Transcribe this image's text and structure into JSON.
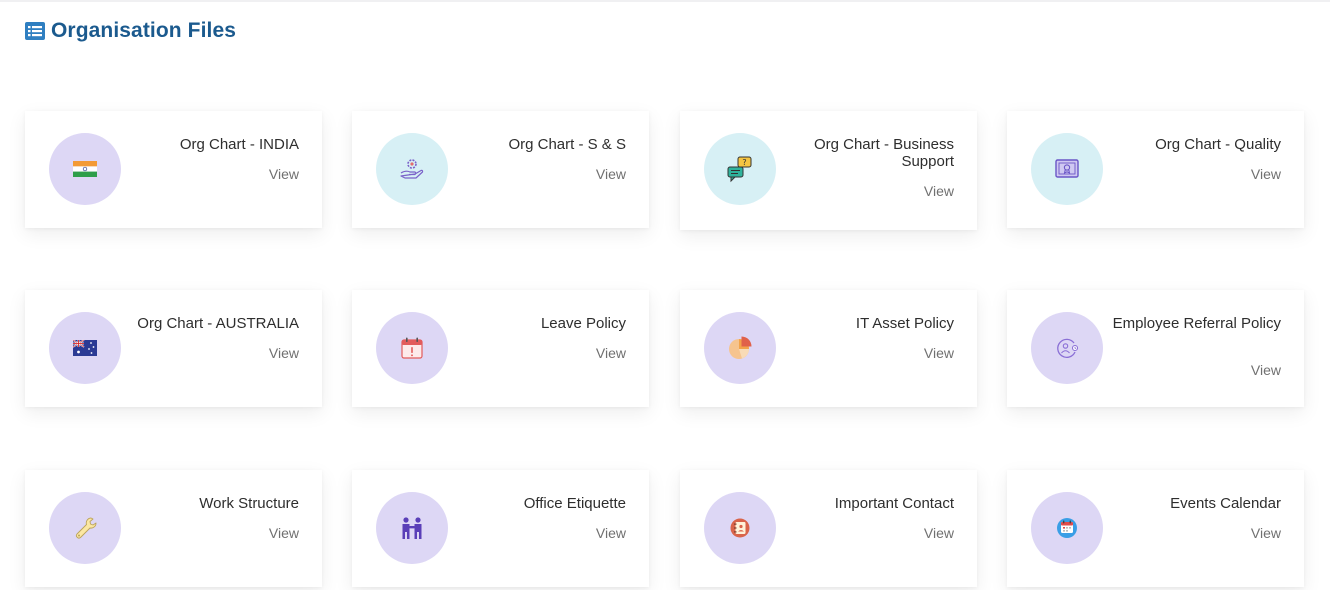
{
  "page": {
    "title": "Organisation Files",
    "title_icon": "list-icon"
  },
  "cards": [
    {
      "name": "Org Chart - INDIA",
      "view": "View",
      "icon": "india-flag-icon",
      "circle": "purple"
    },
    {
      "name": "Org Chart - S & S",
      "view": "View",
      "icon": "care-gear-hand-icon",
      "circle": "cyan"
    },
    {
      "name": "Org Chart - Business Support",
      "view": "View",
      "icon": "chat-question-icon",
      "circle": "cyan"
    },
    {
      "name": "Org Chart - Quality",
      "view": "View",
      "icon": "certificate-icon",
      "circle": "cyan"
    },
    {
      "name": "Org Chart - AUSTRALIA",
      "view": "View",
      "icon": "australia-flag-icon",
      "circle": "purple"
    },
    {
      "name": "Leave Policy",
      "view": "View",
      "icon": "calendar-alert-icon",
      "circle": "purple"
    },
    {
      "name": "IT Asset Policy",
      "view": "View",
      "icon": "pie-chart-icon",
      "circle": "purple"
    },
    {
      "name": "Employee Referral Policy",
      "view": "View",
      "icon": "referral-clock-icon",
      "circle": "purple"
    },
    {
      "name": "Work Structure",
      "view": "View",
      "icon": "wrench-icon",
      "circle": "purple"
    },
    {
      "name": "Office Etiquette",
      "view": "View",
      "icon": "handshake-people-icon",
      "circle": "purple"
    },
    {
      "name": "Important Contact",
      "view": "View",
      "icon": "contact-book-icon",
      "circle": "purple"
    },
    {
      "name": "Events Calendar",
      "view": "View",
      "icon": "calendar-icon",
      "circle": "purple"
    }
  ],
  "colors": {
    "title": "#1b5a8e",
    "circle_purple": "#ddd7f5",
    "circle_cyan": "#d7f0f5"
  }
}
